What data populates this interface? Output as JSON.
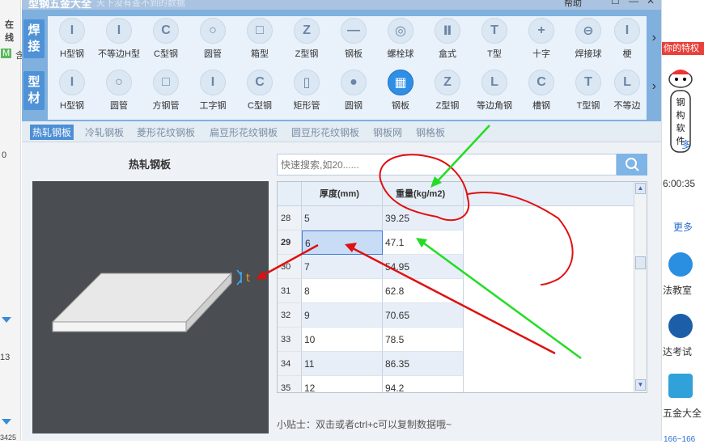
{
  "window": {
    "title": "型钢五金大全",
    "subtitle": "天下没有查不到的数据",
    "help": "帮助"
  },
  "weld_category": "焊接",
  "weld_tools": [
    "H型钢",
    "不等边H型",
    "C型钢",
    "圆管",
    "箱型",
    "Z型钢",
    "钢板",
    "螺栓球",
    "盒式",
    "T型",
    "十字",
    "焊接球",
    "梗"
  ],
  "profile_category": "型材",
  "profile_tools": [
    "H型钢",
    "圆管",
    "方钢管",
    "工字钢",
    "C型钢",
    "矩形管",
    "圆钢",
    "钢板",
    "Z型钢",
    "等边角钢",
    "槽钢",
    "T型钢",
    "不等边"
  ],
  "selected_profile_tool": "钢板",
  "tabs": [
    "热轧钢板",
    "冷轧钢板",
    "菱形花纹钢板",
    "扁豆形花纹钢板",
    "圆豆形花纹钢板",
    "钢板网",
    "钢格板"
  ],
  "active_tab": "热轧钢板",
  "panel_title": "热轧钢板",
  "dimension_label": "t",
  "search_placeholder": "快速搜索,如20......",
  "table": {
    "headers": [
      "厚度(mm)",
      "重量(kg/m2)"
    ],
    "rows": [
      {
        "n": "28",
        "t": "5",
        "w": "39.25"
      },
      {
        "n": "29",
        "t": "6",
        "w": "47.1"
      },
      {
        "n": "30",
        "t": "7",
        "w": "54.95"
      },
      {
        "n": "31",
        "t": "8",
        "w": "62.8"
      },
      {
        "n": "32",
        "t": "9",
        "w": "70.65"
      },
      {
        "n": "33",
        "t": "10",
        "w": "78.5"
      },
      {
        "n": "34",
        "t": "11",
        "w": "86.35"
      },
      {
        "n": "35",
        "t": "12",
        "w": "94.2"
      }
    ],
    "selected_row_number": "29"
  },
  "tip": "小贴士：双击或者ctrl+c可以复制数据哦~",
  "background_left": {
    "items": [
      "在线",
      "含",
      "0",
      "13",
      "3425"
    ]
  },
  "background_right": {
    "promo": "你的特权",
    "items": [
      "多",
      "6:00:35",
      "更多",
      "法教室",
      "达考试",
      "五金大全",
      "166~166"
    ],
    "mascot_text": "钢构软件"
  },
  "colors": {
    "accent": "#2f8ee6",
    "annotation_red": "#e01010",
    "annotation_green": "#22dd22"
  },
  "icons": {
    "search": "search-icon",
    "close": "close-icon",
    "scroll_up": "scroll-up-icon",
    "scroll_down": "scroll-down-icon",
    "next": "chevron-right-icon"
  }
}
